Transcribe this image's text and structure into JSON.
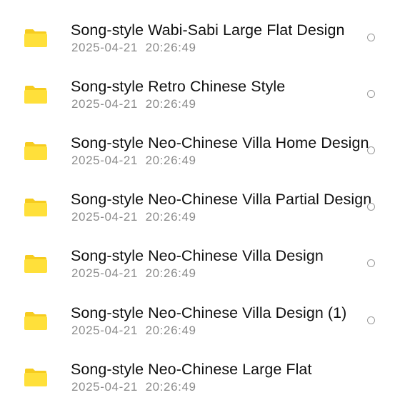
{
  "colors": {
    "folder_body": "#FFE03A",
    "folder_tab": "#F6CC1F",
    "name_text": "#111111",
    "date_text": "#8C8C8C",
    "radio_border": "#9A9A9A"
  },
  "files": [
    {
      "name": "Song-style Wabi-Sabi Large Flat Design",
      "date": "2025-04-21  20:26:49",
      "icon": "folder-icon"
    },
    {
      "name": "Song-style Retro Chinese Style",
      "date": "2025-04-21  20:26:49",
      "icon": "folder-icon"
    },
    {
      "name": "Song-style Neo-Chinese Villa Home Design",
      "date": "2025-04-21  20:26:49",
      "icon": "folder-icon"
    },
    {
      "name": "Song-style Neo-Chinese Villa Partial Design",
      "date": "2025-04-21  20:26:49",
      "icon": "folder-icon"
    },
    {
      "name": "Song-style Neo-Chinese Villa Design",
      "date": "2025-04-21  20:26:49",
      "icon": "folder-icon"
    },
    {
      "name": "Song-style Neo-Chinese Villa Design (1)",
      "date": "2025-04-21  20:26:49",
      "icon": "folder-icon"
    },
    {
      "name": "Song-style Neo-Chinese Large Flat",
      "date": "2025-04-21  20:26:49",
      "icon": "folder-icon"
    }
  ]
}
